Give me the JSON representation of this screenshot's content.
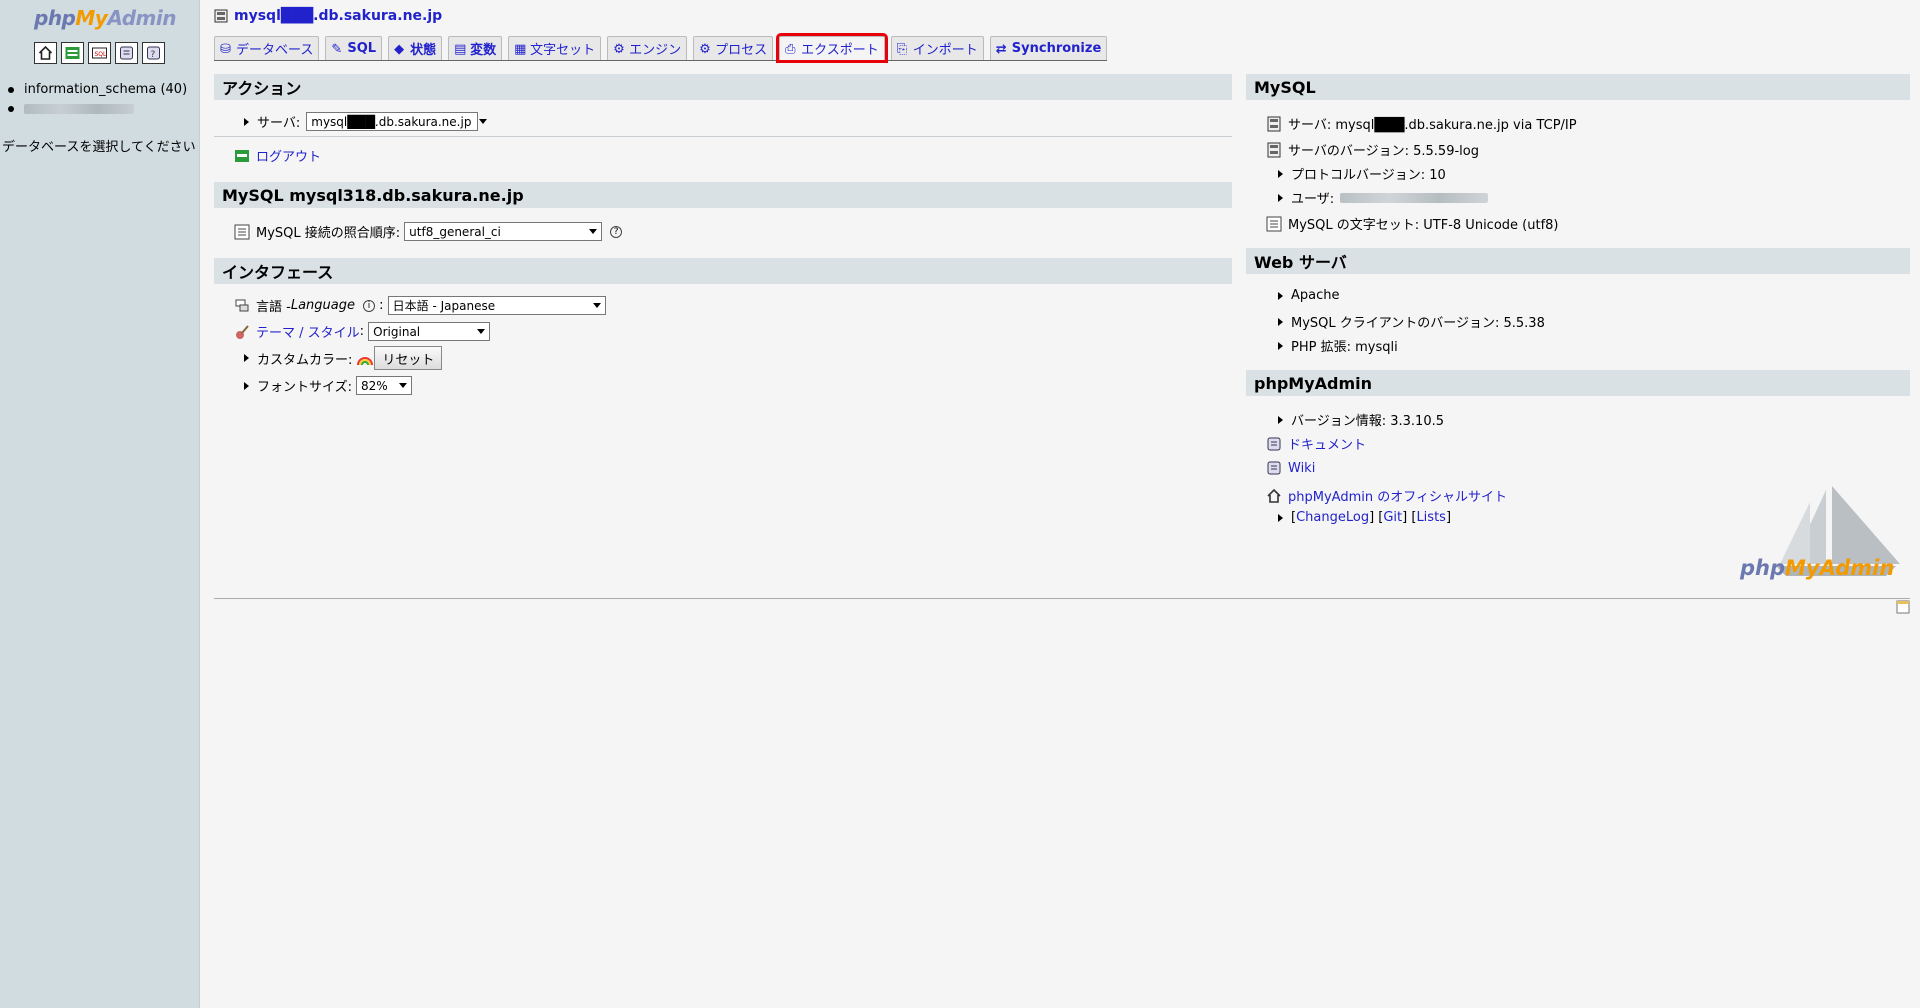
{
  "nav": {
    "logo": {
      "php": "php",
      "my": "My",
      "admin": "Admin"
    },
    "icons": [
      "home-icon",
      "query-window-icon",
      "sql-icon",
      "docs-icon",
      "help-icon"
    ],
    "databases": [
      {
        "label": "information_schema (40)"
      },
      {
        "label": "",
        "redacted": true
      }
    ],
    "hint": "データベースを選択してください"
  },
  "header": {
    "server": "mysql███.db.sakura.ne.jp",
    "tabs": [
      {
        "label": "データベース",
        "icon": "database-icon"
      },
      {
        "label": "SQL",
        "icon": "sql-icon"
      },
      {
        "label": "状態",
        "icon": "status-icon"
      },
      {
        "label": "変数",
        "icon": "variables-icon"
      },
      {
        "label": "文字セット",
        "icon": "charset-icon"
      },
      {
        "label": "エンジン",
        "icon": "engine-icon"
      },
      {
        "label": "プロセス",
        "icon": "process-icon"
      },
      {
        "label": "エクスポート",
        "icon": "export-icon",
        "highlighted": true
      },
      {
        "label": "インポート",
        "icon": "import-icon"
      },
      {
        "label": "Synchronize",
        "icon": "sync-icon"
      }
    ]
  },
  "actions": {
    "title": "アクション",
    "server_label": "サーバ:",
    "server_value": "mysql███.db.sakura.ne.jp",
    "logout": "ログアウト"
  },
  "mysql_local": {
    "title": "MySQL mysql318.db.sakura.ne.jp",
    "collation_label": "MySQL 接続の照合順序:",
    "collation_value": "utf8_general_ci"
  },
  "interface": {
    "title": "インタフェース",
    "lang_label": "言語 - ",
    "lang_italic": "Language",
    "lang_value": "日本語 - Japanese",
    "theme_label": "テーマ / スタイル",
    "theme_value": "Original",
    "custom_color_label": "カスタムカラー:",
    "reset_button": "リセット",
    "font_size_label": "フォントサイズ:",
    "font_size_value": "82%"
  },
  "mysql_info": {
    "title": "MySQL",
    "server": "サーバ: mysql███.db.sakura.ne.jp via TCP/IP",
    "version": "サーバのバージョン: 5.5.59-log",
    "protocol": "プロトコルバージョン: 10",
    "user_label": "ユーザ:",
    "charset": "MySQL の文字セット: UTF-8 Unicode (utf8)"
  },
  "web_server": {
    "title": "Web サーバ",
    "software": "Apache",
    "client_version": "MySQL クライアントのバージョン: 5.5.38",
    "php_ext": "PHP 拡張: mysqli"
  },
  "pma": {
    "title": "phpMyAdmin",
    "version": "バージョン情報: 3.3.10.5",
    "docs": "ドキュメント",
    "wiki": "Wiki",
    "official": "phpMyAdmin のオフィシャルサイト",
    "bracket_open": "[",
    "changelog": "ChangeLog",
    "bracket_mid1": "] [",
    "git": "Git",
    "bracket_mid2": "] [",
    "lists": "Lists",
    "bracket_close": "]"
  }
}
